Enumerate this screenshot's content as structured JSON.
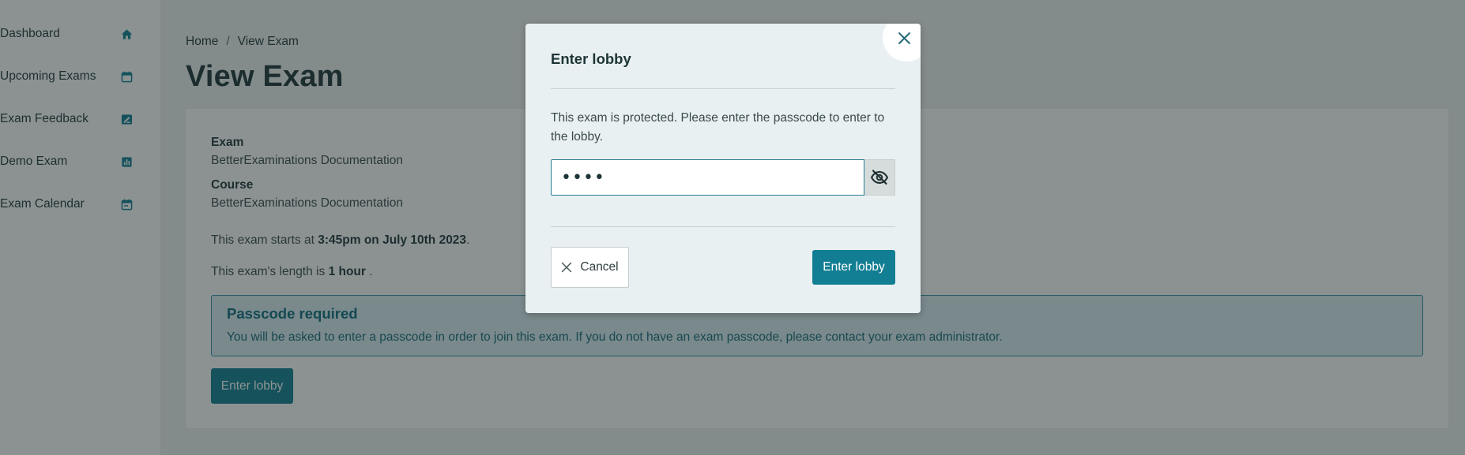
{
  "sidebar": {
    "items": [
      {
        "label": "Dashboard",
        "icon": "home-icon"
      },
      {
        "label": "Upcoming Exams",
        "icon": "calendar-icon"
      },
      {
        "label": "Exam Feedback",
        "icon": "feedback-icon"
      },
      {
        "label": "Demo Exam",
        "icon": "chart-icon"
      },
      {
        "label": "Exam Calendar",
        "icon": "calendar-icon"
      }
    ]
  },
  "breadcrumb": {
    "home": "Home",
    "separator": "/",
    "current": "View Exam"
  },
  "page": {
    "title": "View Exam"
  },
  "exam": {
    "exam_label": "Exam",
    "exam_value": "BetterExaminations Documentation",
    "course_label": "Course",
    "course_value": "BetterExaminations Documentation",
    "starts_prefix": "This exam starts at",
    "starts_value": "3:45pm on July 10th 2023",
    "starts_suffix": ".",
    "length_prefix": "This exam's length is",
    "length_value": "1 hour",
    "length_suffix": "."
  },
  "alert": {
    "title": "Passcode required",
    "text": "You will be asked to enter a passcode in order to join this exam. If you do not have an exam passcode, please contact your exam administrator."
  },
  "main_button": {
    "label": "Enter lobby"
  },
  "modal": {
    "title": "Enter lobby",
    "body": "This exam is protected. Please enter the passcode to enter to the lobby.",
    "passcode_value": "••••",
    "cancel_label": "Cancel",
    "submit_label": "Enter lobby"
  },
  "colors": {
    "accent": "#117e93",
    "alert_background": "#d8edf2",
    "alert_border": "#2f8fa3",
    "overlay": "rgba(26, 38, 38, 0.50)"
  }
}
